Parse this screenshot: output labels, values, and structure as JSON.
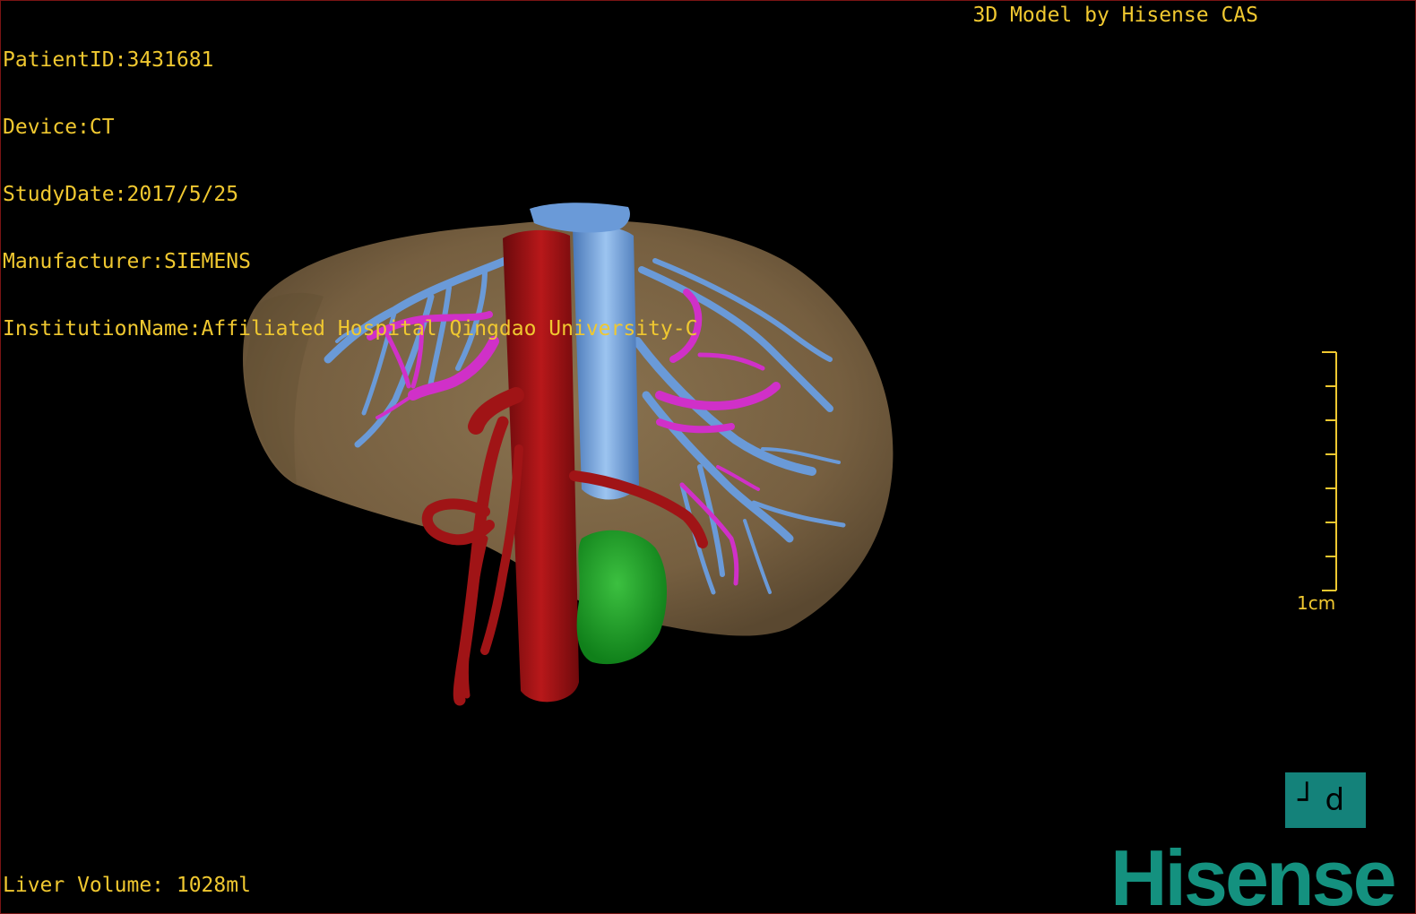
{
  "header": {
    "patient_id": "PatientID:3431681",
    "device": "Device:CT",
    "study_date": "StudyDate:2017/5/25",
    "manufacturer": "Manufacturer:SIEMENS",
    "institution": "InstitutionName:Affiliated Hospital Qingdao University-C"
  },
  "credit": "3D Model by Hisense CAS",
  "footer": {
    "liver_volume": "Liver Volume: 1028ml"
  },
  "scale": {
    "label": "1cm"
  },
  "orientation": {
    "label": "┘d"
  },
  "brand": {
    "name": "Hisense"
  },
  "colors": {
    "text": "#f0c830",
    "liver": "#7a6444",
    "artery": "#a01416",
    "portal_vein": "#6a9ad8",
    "hepatic_vein": "#d030c8",
    "tumor": "#20a030",
    "brand": "#14917f"
  }
}
